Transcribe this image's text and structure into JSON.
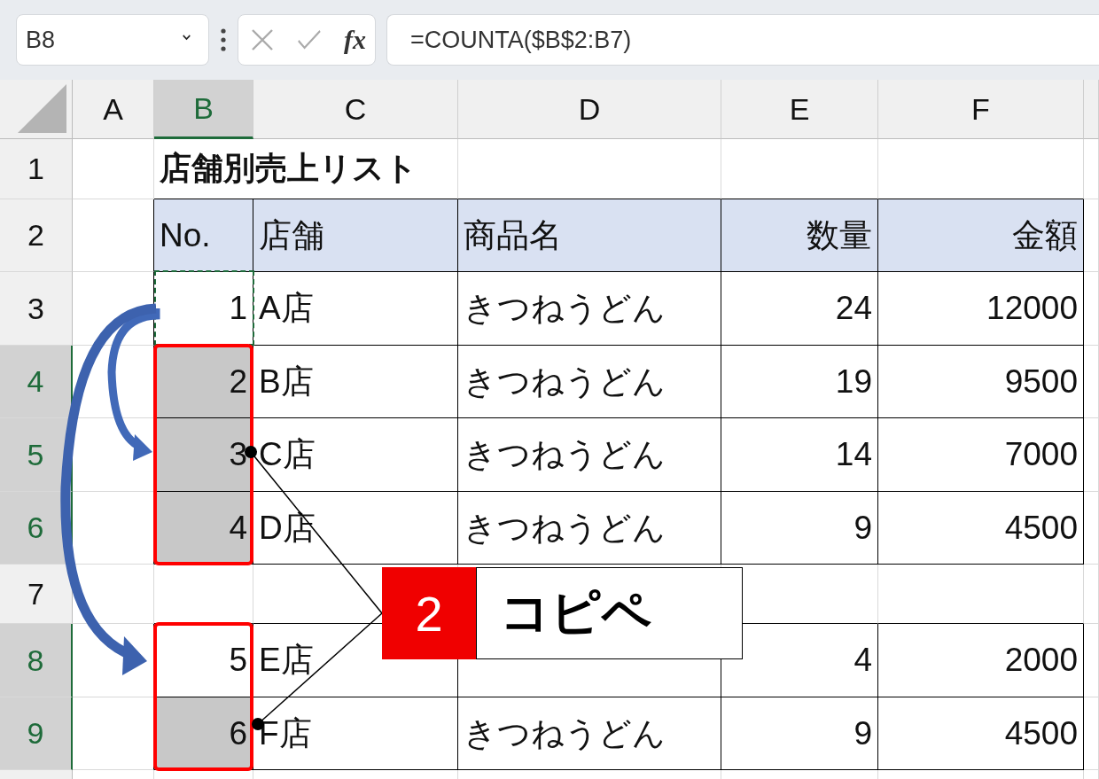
{
  "formula_bar": {
    "name_box": "B8",
    "function_label": "fx",
    "formula": "=COUNTA($B$2:B7)"
  },
  "columns": [
    {
      "label": "A",
      "selected": false
    },
    {
      "label": "B",
      "selected": true
    },
    {
      "label": "C",
      "selected": false
    },
    {
      "label": "D",
      "selected": false
    },
    {
      "label": "E",
      "selected": false
    },
    {
      "label": "F",
      "selected": false
    }
  ],
  "rows": [
    {
      "label": "1",
      "selected": false,
      "kind": "title",
      "title": "店舗別売上リスト"
    },
    {
      "label": "2",
      "selected": false,
      "kind": "header",
      "cells": [
        "No.",
        "店舗",
        "商品名",
        "数量",
        "金額"
      ]
    },
    {
      "label": "3",
      "selected": false,
      "kind": "data",
      "cells": [
        "1",
        "A店",
        "きつねうどん",
        "24",
        "12000"
      ],
      "cell_b": {
        "selected": false,
        "boxed": false,
        "copy_source": true
      }
    },
    {
      "label": "4",
      "selected": true,
      "kind": "data",
      "cells": [
        "2",
        "B店",
        "きつねうどん",
        "19",
        "9500"
      ],
      "cell_b": {
        "selected": true,
        "boxed": true,
        "copy_source": false
      }
    },
    {
      "label": "5",
      "selected": true,
      "kind": "data",
      "cells": [
        "3",
        "C店",
        "きつねうどん",
        "14",
        "7000"
      ],
      "cell_b": {
        "selected": true,
        "boxed": true,
        "copy_source": false
      }
    },
    {
      "label": "6",
      "selected": true,
      "kind": "data",
      "cells": [
        "4",
        "D店",
        "きつねうどん",
        "9",
        "4500"
      ],
      "cell_b": {
        "selected": true,
        "boxed": true,
        "copy_source": false
      }
    },
    {
      "label": "7",
      "selected": false,
      "kind": "blank"
    },
    {
      "label": "8",
      "selected": true,
      "kind": "data",
      "cells": [
        "5",
        "E店",
        null,
        "4",
        "2000"
      ],
      "cell_b": {
        "selected": false,
        "boxed": true,
        "copy_source": false
      }
    },
    {
      "label": "9",
      "selected": true,
      "kind": "data",
      "cells": [
        "6",
        "F店",
        "きつねうどん",
        "9",
        "4500"
      ],
      "cell_b": {
        "selected": true,
        "boxed": true,
        "copy_source": false
      }
    }
  ],
  "callout": {
    "number": "2",
    "text": "コピペ"
  }
}
